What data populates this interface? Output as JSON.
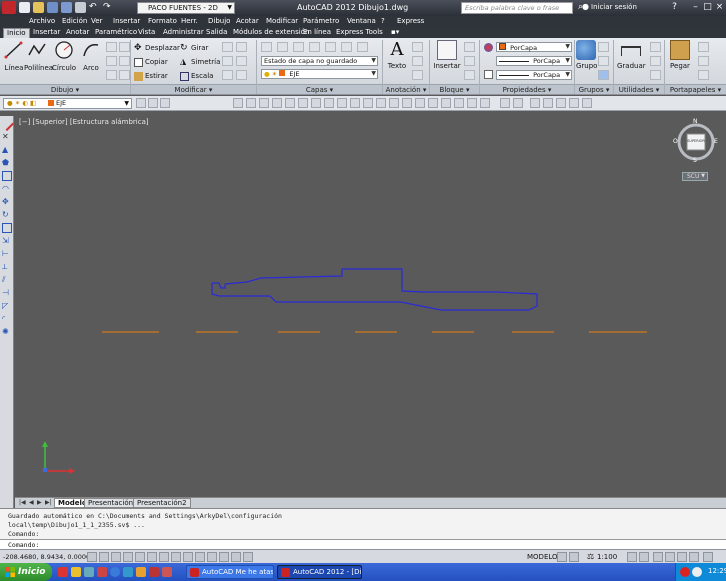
{
  "window": {
    "title": "AutoCAD 2012    Dibujo1.dwg",
    "workspace": "PACO FUENTES - 2D",
    "search_placeholder": "Escriba palabra clave o frase",
    "login_label": "Iniciar sesión"
  },
  "menu": [
    "Archivo",
    "Edición",
    "Ver",
    "Insertar",
    "Formato",
    "Herr.",
    "Dibujo",
    "Acotar",
    "Modificar",
    "Parámetro",
    "Ventana",
    "?",
    "Express"
  ],
  "ribbon_tabs": [
    "Inicio",
    "Insertar",
    "Anotar",
    "Paramétrico",
    "Vista",
    "Administrar",
    "Salida",
    "Módulos de extensión",
    "En línea",
    "Express Tools"
  ],
  "ribbon": {
    "dibujo": {
      "label": "Dibujo",
      "tools": [
        "Línea",
        "Polilínea",
        "Círculo",
        "Arco"
      ]
    },
    "modificar": {
      "label": "Modificar",
      "tools": [
        "Desplazar",
        "Girar",
        "Copiar",
        "Simetría",
        "Estirar",
        "Escala"
      ]
    },
    "capas": {
      "label": "Capas",
      "state_combo": "Estado de capa no guardado",
      "layer_combo": "EJE"
    },
    "anotacion": {
      "label": "Anotación",
      "texto": "Texto"
    },
    "bloque": {
      "label": "Bloque",
      "insertar": "Insertar"
    },
    "propiedades": {
      "label": "Propiedades",
      "color": "PorCapa",
      "linetype": "PorCapa",
      "lineweight": "PorCapa"
    },
    "grupos": {
      "label": "Grupos",
      "grupo": "Grupo"
    },
    "utilidades": {
      "label": "Utilidades",
      "graduar": "Graduar"
    },
    "portapapeles": {
      "label": "Portapapeles",
      "pegar": "Pegar"
    }
  },
  "layer_toolbar": {
    "layer": "EJE"
  },
  "viewport": {
    "label": "[−] [Superior] [Estructura alámbrica]",
    "viewcube": {
      "n": "N",
      "s": "S",
      "e": "E",
      "w": "O",
      "face": "SUPERIOR"
    },
    "ucs_button": "SCU"
  },
  "layout_tabs": [
    "Modelo",
    "Presentación1",
    "Presentación2"
  ],
  "command": {
    "history": [
      "Guardado automático en C:\\Documents and Settings\\ArkyDel\\configuración",
      "local\\temp\\Dibujo1_1_1_2355.sv$ ...",
      "Comando:"
    ],
    "prompt": "Comando:"
  },
  "status": {
    "coords": "-208.4680, 8.9434, 0.0000",
    "space": "MODELO",
    "scale": "1:100"
  },
  "taskbar": {
    "start": "Inicio",
    "items": [
      "AutoCAD Me he atas...",
      "AutoCAD 2012 - [Dib..."
    ],
    "clock": "12:29"
  },
  "colors": {
    "profile_line": "#2a2ad8",
    "axis_line": "#d07a1a",
    "background": "#5a5a5a"
  }
}
